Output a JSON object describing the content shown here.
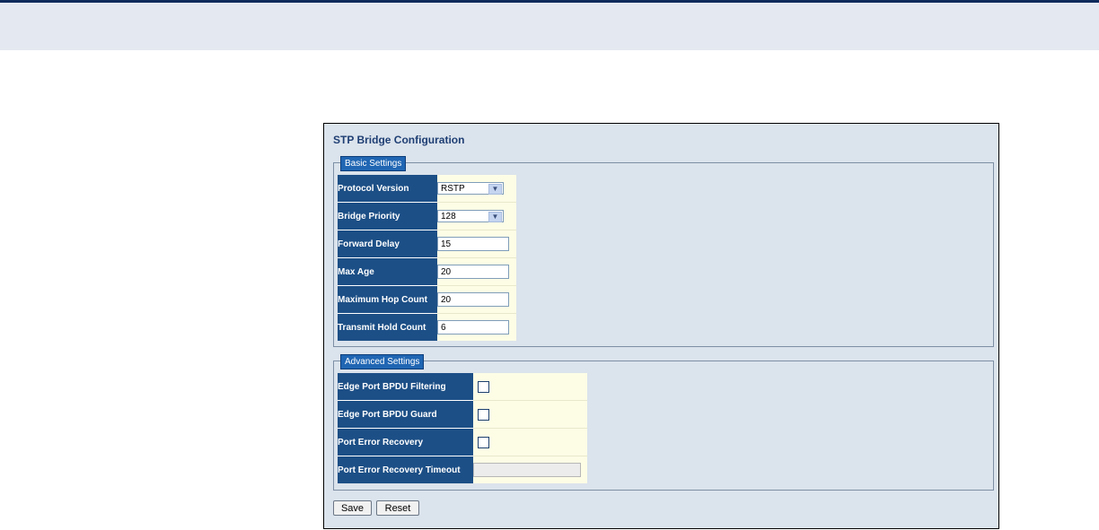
{
  "page": {
    "title": "STP Bridge Configuration"
  },
  "basic": {
    "legend": "Basic Settings",
    "rows": [
      {
        "label": "Protocol Version",
        "value": "RSTP"
      },
      {
        "label": "Bridge Priority",
        "value": "128"
      },
      {
        "label": "Forward Delay",
        "value": "15"
      },
      {
        "label": "Max Age",
        "value": "20"
      },
      {
        "label": "Maximum Hop Count",
        "value": "20"
      },
      {
        "label": "Transmit Hold Count",
        "value": "6"
      }
    ]
  },
  "advanced": {
    "legend": "Advanced Settings",
    "rows": [
      {
        "label": "Edge Port BPDU Filtering",
        "checked": false
      },
      {
        "label": "Edge Port BPDU Guard",
        "checked": false
      },
      {
        "label": "Port Error Recovery",
        "checked": false
      },
      {
        "label": "Port Error Recovery Timeout",
        "value": ""
      }
    ]
  },
  "buttons": {
    "save": "Save",
    "reset": "Reset"
  },
  "colors": {
    "header_line": "#0d2a5c",
    "label_bg": "#1c4f86",
    "value_bg": "#fdfde6",
    "panel_bg": "#dbe3ec",
    "legend_bg": "#2066b3"
  },
  "icons": {
    "dropdown": "chevron-down-icon"
  }
}
